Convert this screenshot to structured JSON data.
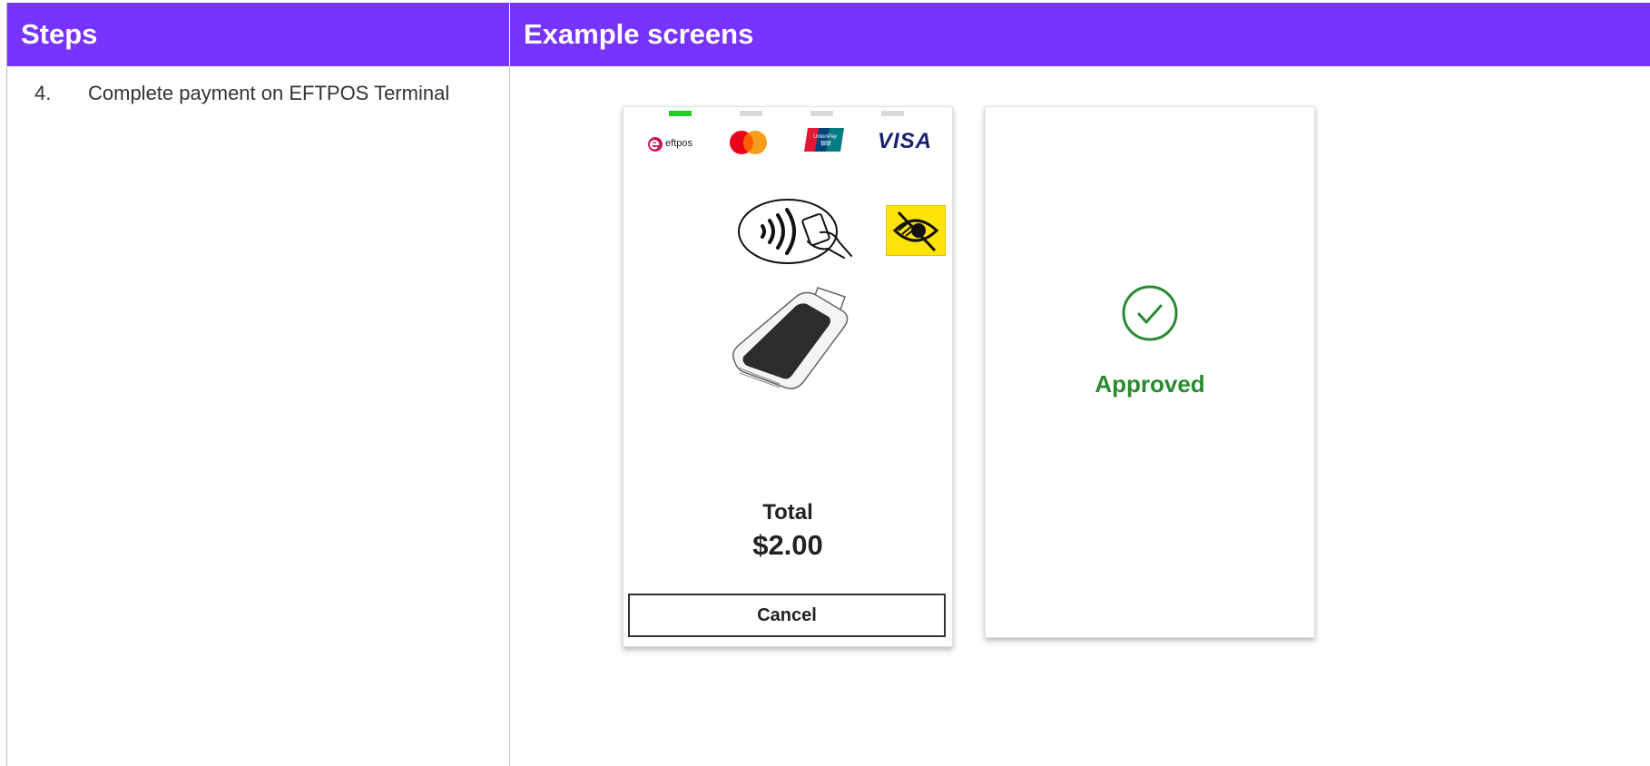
{
  "header": {
    "steps_title": "Steps",
    "screens_title": "Example screens"
  },
  "step": {
    "number": "4.",
    "text": "Complete payment on EFTPOS Terminal"
  },
  "terminal_screen": {
    "card_brands": [
      "eftpos",
      "mastercard",
      "unionpay",
      "visa"
    ],
    "eftpos_label": "eftpos",
    "visa_label": "VISA",
    "total_label": "Total",
    "total_amount": "$2.00",
    "cancel_label": "Cancel"
  },
  "approved_screen": {
    "status_text": "Approved"
  },
  "colors": {
    "header_bg": "#7733ff",
    "approved_green": "#2a8a32",
    "eftpos_magenta": "#c8195a",
    "visa_blue": "#1a1f71",
    "indicator_active": "#22cc22"
  }
}
